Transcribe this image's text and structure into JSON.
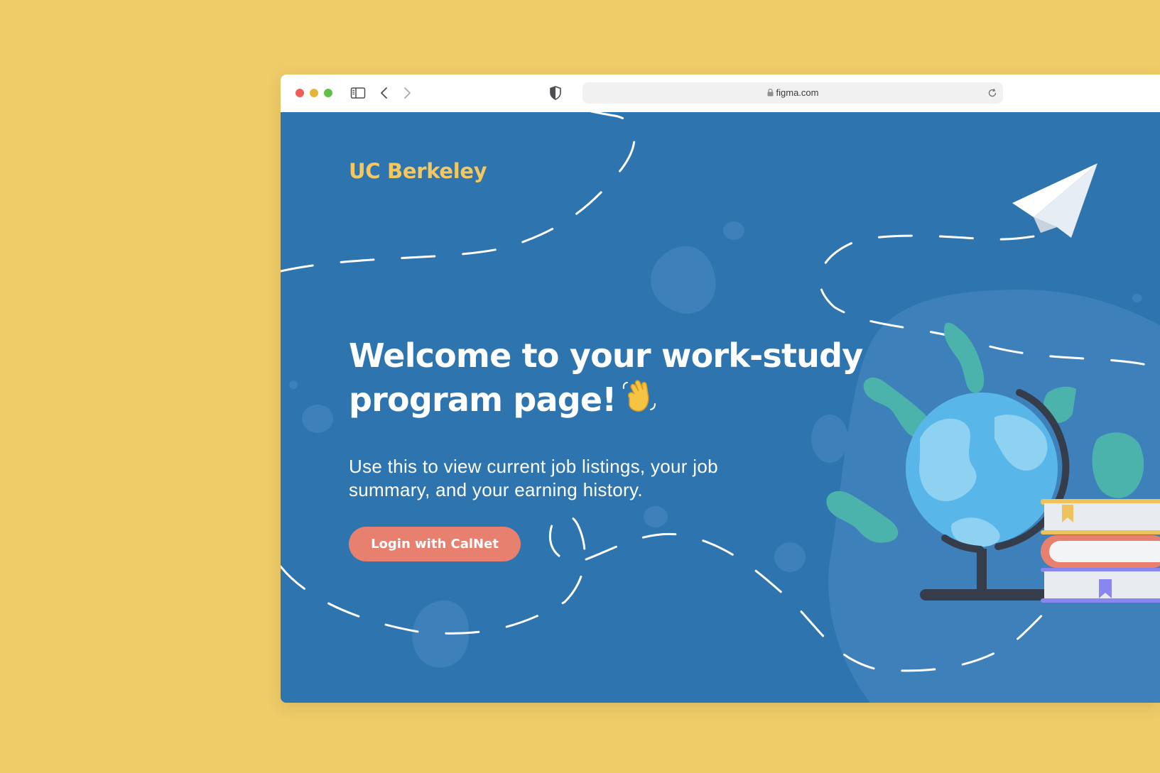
{
  "browser": {
    "url": "figma.com",
    "window_controls": [
      "close",
      "minimize",
      "zoom"
    ],
    "icons": [
      "sidebar-icon",
      "back-icon",
      "forward-icon",
      "shield-icon",
      "lock-icon",
      "reload-icon"
    ]
  },
  "page": {
    "brand": "UC Berkeley",
    "headline_line1": "Welcome to your work-study",
    "headline_line2": "program page!",
    "headline_emoji": "waving-hand",
    "subtitle": "Use this to view current job listings, your job summary, and your earning history.",
    "login_button": "Login with CalNet"
  },
  "illustration": [
    "paper-plane",
    "globe",
    "stack-of-books",
    "leaves",
    "dashed-flight-path"
  ],
  "colors": {
    "outer_background": "#efcc68",
    "page_background": "#2e74ae",
    "brand_text": "#f4c85e",
    "button": "#e8806f",
    "text": "#ffffff"
  }
}
